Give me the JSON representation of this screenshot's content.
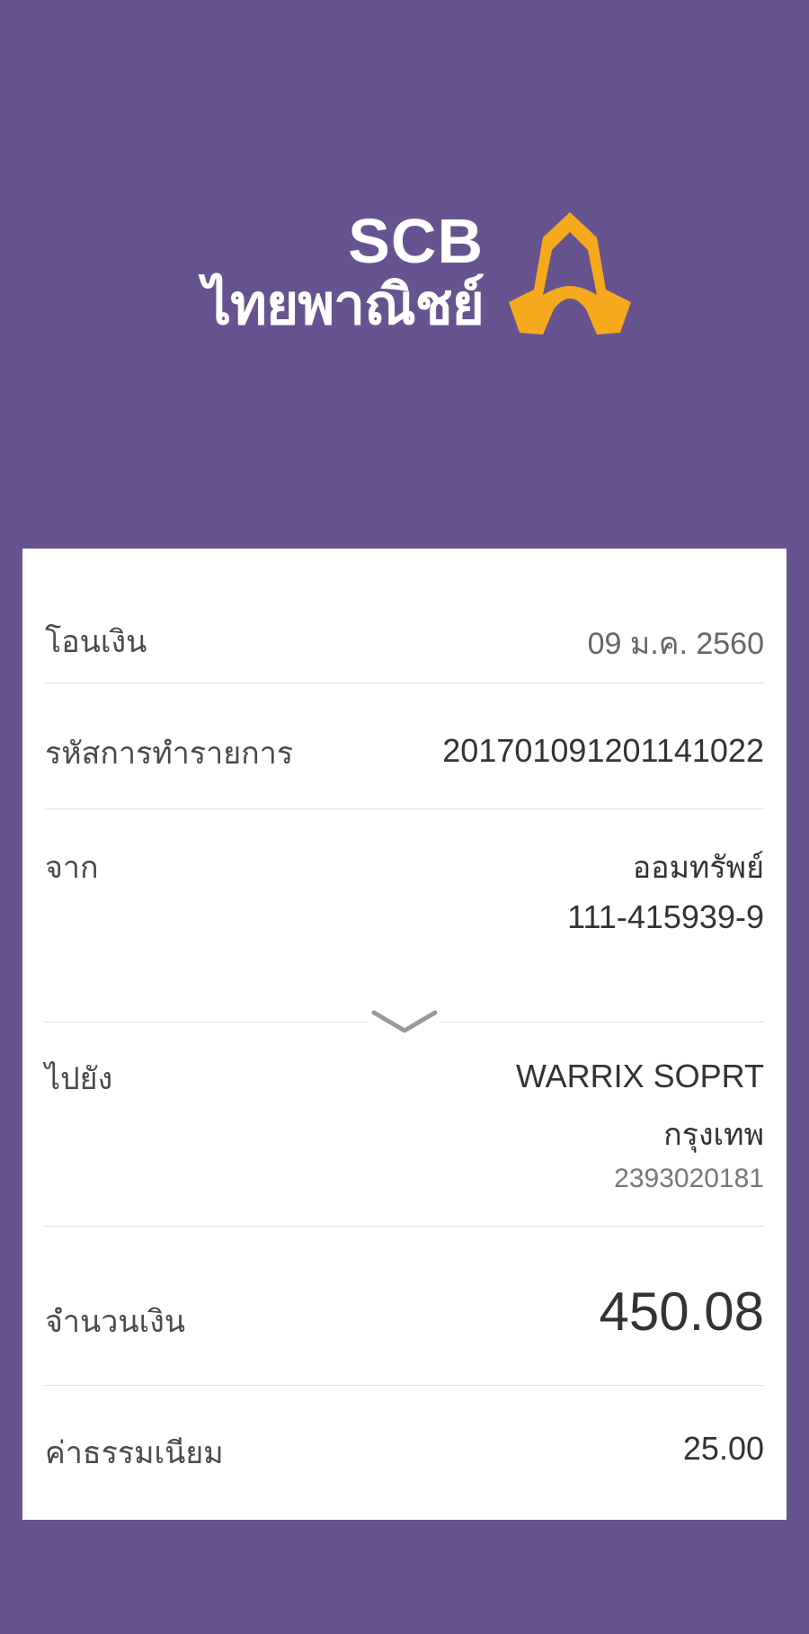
{
  "brand": {
    "logo_en": "SCB",
    "logo_th": "ไทยพาณิชย์",
    "emblem_color": "#F5A91C"
  },
  "receipt": {
    "type_label": "โอนเงิน",
    "date": "09 ม.ค. 2560",
    "ref_label": "รหัสการทำรายการ",
    "ref_value": "20170109120114​1022",
    "from_label": "จาก",
    "from_account_type": "ออมทรัพย์",
    "from_account_no": "111-415939-9",
    "to_label": "ไปยัง",
    "to_name": "WARRIX SOPRT",
    "to_bank": "กรุงเทพ",
    "to_account_no": "2393020181",
    "amount_label": "จำนวนเงิน",
    "amount": "450.08",
    "fee_label": "ค่าธรรมเนียม",
    "fee": "25.00"
  },
  "icons": {
    "expand": "chevron-down-icon",
    "emblem": "scb-emblem-icon"
  },
  "colors": {
    "background": "#675390",
    "card": "#FFFFFF",
    "divider": "#DEDEDE"
  }
}
